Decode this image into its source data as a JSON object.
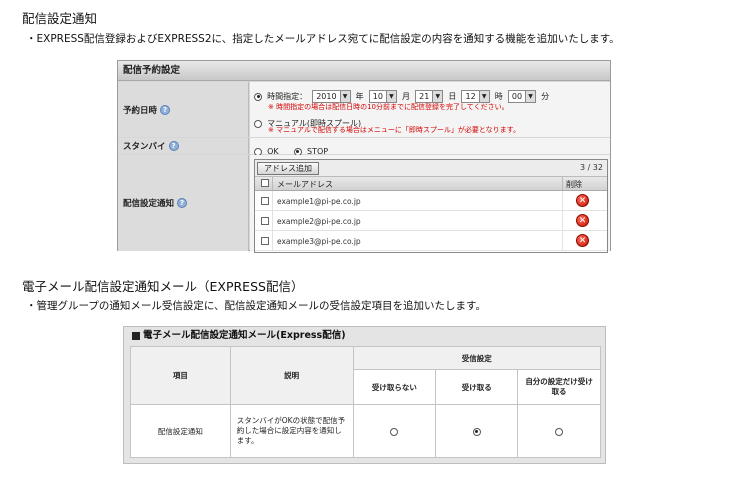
{
  "section1": {
    "title": "配信設定通知",
    "note": "・EXPRESS配信登録およびEXPRESS2に、指定したメールアドレス宛てに配信設定の内容を通知する機能を追加いたします。"
  },
  "panel1": {
    "title": "配信予約設定",
    "rows": {
      "schedule_label": "予約日時",
      "standby_label": "スタンバイ",
      "notify_label": "配信設定通知"
    },
    "time_option_label": "時間指定：",
    "year": "2010",
    "year_unit": "年",
    "month": "10",
    "month_unit": "月",
    "day": "21",
    "day_unit": "日",
    "hour": "12",
    "hour_unit": "時",
    "minute": "00",
    "minute_unit": "分",
    "time_warning": "※ 時間指定の場合は配信日時の10分前までに配信登録を完了してください。",
    "manual_option_label": "マニュアル(即時スプール)",
    "manual_warning": "※ マニュアルで配信する場合はメニューに「即時スプール」が必要となります。",
    "standby_ok": "OK",
    "standby_stop": "STOP",
    "add_address_button": "アドレス追加",
    "count": "3 / 32",
    "col_email": "メールアドレス",
    "col_delete": "削除",
    "emails": [
      "example1@pi-pe.co.jp",
      "example2@pi-pe.co.jp",
      "example3@pi-pe.co.jp"
    ],
    "help_glyph": "?",
    "delete_glyph": "✕"
  },
  "section2": {
    "title": "電子メール配信設定通知メール（EXPRESS配信）",
    "note": "・管理グループの通知メール受信設定に、配信設定通知メールの受信設定項目を追加いたします。"
  },
  "panel2": {
    "title": "電子メール配信設定通知メール(Express配信)",
    "col_item": "項目",
    "col_desc": "説明",
    "col_receive": "受信設定",
    "opt_no": "受け取らない",
    "opt_yes": "受け取る",
    "opt_own": "自分の設定だけ受け取る",
    "row_item": "配信設定通知",
    "row_desc": "スタンバイがOKの状態で配信予約した場合に設定内容を通知します。"
  }
}
